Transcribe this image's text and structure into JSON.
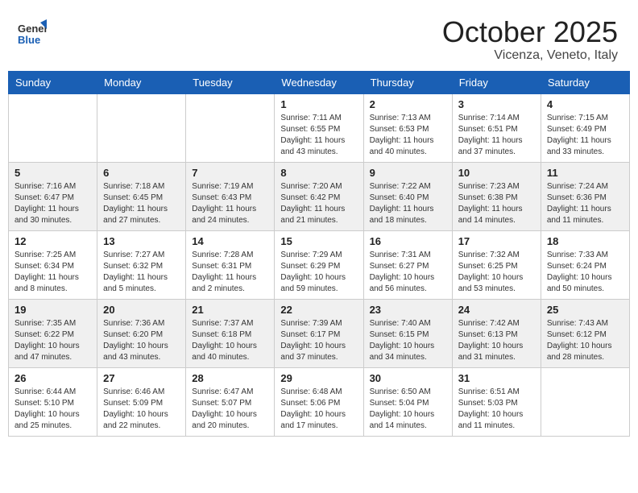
{
  "header": {
    "logo_general": "General",
    "logo_blue": "Blue",
    "month_title": "October 2025",
    "location": "Vicenza, Veneto, Italy"
  },
  "days_of_week": [
    "Sunday",
    "Monday",
    "Tuesday",
    "Wednesday",
    "Thursday",
    "Friday",
    "Saturday"
  ],
  "weeks": [
    [
      {
        "day": "",
        "info": ""
      },
      {
        "day": "",
        "info": ""
      },
      {
        "day": "",
        "info": ""
      },
      {
        "day": "1",
        "info": "Sunrise: 7:11 AM\nSunset: 6:55 PM\nDaylight: 11 hours and 43 minutes."
      },
      {
        "day": "2",
        "info": "Sunrise: 7:13 AM\nSunset: 6:53 PM\nDaylight: 11 hours and 40 minutes."
      },
      {
        "day": "3",
        "info": "Sunrise: 7:14 AM\nSunset: 6:51 PM\nDaylight: 11 hours and 37 minutes."
      },
      {
        "day": "4",
        "info": "Sunrise: 7:15 AM\nSunset: 6:49 PM\nDaylight: 11 hours and 33 minutes."
      }
    ],
    [
      {
        "day": "5",
        "info": "Sunrise: 7:16 AM\nSunset: 6:47 PM\nDaylight: 11 hours and 30 minutes."
      },
      {
        "day": "6",
        "info": "Sunrise: 7:18 AM\nSunset: 6:45 PM\nDaylight: 11 hours and 27 minutes."
      },
      {
        "day": "7",
        "info": "Sunrise: 7:19 AM\nSunset: 6:43 PM\nDaylight: 11 hours and 24 minutes."
      },
      {
        "day": "8",
        "info": "Sunrise: 7:20 AM\nSunset: 6:42 PM\nDaylight: 11 hours and 21 minutes."
      },
      {
        "day": "9",
        "info": "Sunrise: 7:22 AM\nSunset: 6:40 PM\nDaylight: 11 hours and 18 minutes."
      },
      {
        "day": "10",
        "info": "Sunrise: 7:23 AM\nSunset: 6:38 PM\nDaylight: 11 hours and 14 minutes."
      },
      {
        "day": "11",
        "info": "Sunrise: 7:24 AM\nSunset: 6:36 PM\nDaylight: 11 hours and 11 minutes."
      }
    ],
    [
      {
        "day": "12",
        "info": "Sunrise: 7:25 AM\nSunset: 6:34 PM\nDaylight: 11 hours and 8 minutes."
      },
      {
        "day": "13",
        "info": "Sunrise: 7:27 AM\nSunset: 6:32 PM\nDaylight: 11 hours and 5 minutes."
      },
      {
        "day": "14",
        "info": "Sunrise: 7:28 AM\nSunset: 6:31 PM\nDaylight: 11 hours and 2 minutes."
      },
      {
        "day": "15",
        "info": "Sunrise: 7:29 AM\nSunset: 6:29 PM\nDaylight: 10 hours and 59 minutes."
      },
      {
        "day": "16",
        "info": "Sunrise: 7:31 AM\nSunset: 6:27 PM\nDaylight: 10 hours and 56 minutes."
      },
      {
        "day": "17",
        "info": "Sunrise: 7:32 AM\nSunset: 6:25 PM\nDaylight: 10 hours and 53 minutes."
      },
      {
        "day": "18",
        "info": "Sunrise: 7:33 AM\nSunset: 6:24 PM\nDaylight: 10 hours and 50 minutes."
      }
    ],
    [
      {
        "day": "19",
        "info": "Sunrise: 7:35 AM\nSunset: 6:22 PM\nDaylight: 10 hours and 47 minutes."
      },
      {
        "day": "20",
        "info": "Sunrise: 7:36 AM\nSunset: 6:20 PM\nDaylight: 10 hours and 43 minutes."
      },
      {
        "day": "21",
        "info": "Sunrise: 7:37 AM\nSunset: 6:18 PM\nDaylight: 10 hours and 40 minutes."
      },
      {
        "day": "22",
        "info": "Sunrise: 7:39 AM\nSunset: 6:17 PM\nDaylight: 10 hours and 37 minutes."
      },
      {
        "day": "23",
        "info": "Sunrise: 7:40 AM\nSunset: 6:15 PM\nDaylight: 10 hours and 34 minutes."
      },
      {
        "day": "24",
        "info": "Sunrise: 7:42 AM\nSunset: 6:13 PM\nDaylight: 10 hours and 31 minutes."
      },
      {
        "day": "25",
        "info": "Sunrise: 7:43 AM\nSunset: 6:12 PM\nDaylight: 10 hours and 28 minutes."
      }
    ],
    [
      {
        "day": "26",
        "info": "Sunrise: 6:44 AM\nSunset: 5:10 PM\nDaylight: 10 hours and 25 minutes."
      },
      {
        "day": "27",
        "info": "Sunrise: 6:46 AM\nSunset: 5:09 PM\nDaylight: 10 hours and 22 minutes."
      },
      {
        "day": "28",
        "info": "Sunrise: 6:47 AM\nSunset: 5:07 PM\nDaylight: 10 hours and 20 minutes."
      },
      {
        "day": "29",
        "info": "Sunrise: 6:48 AM\nSunset: 5:06 PM\nDaylight: 10 hours and 17 minutes."
      },
      {
        "day": "30",
        "info": "Sunrise: 6:50 AM\nSunset: 5:04 PM\nDaylight: 10 hours and 14 minutes."
      },
      {
        "day": "31",
        "info": "Sunrise: 6:51 AM\nSunset: 5:03 PM\nDaylight: 10 hours and 11 minutes."
      },
      {
        "day": "",
        "info": ""
      }
    ]
  ]
}
